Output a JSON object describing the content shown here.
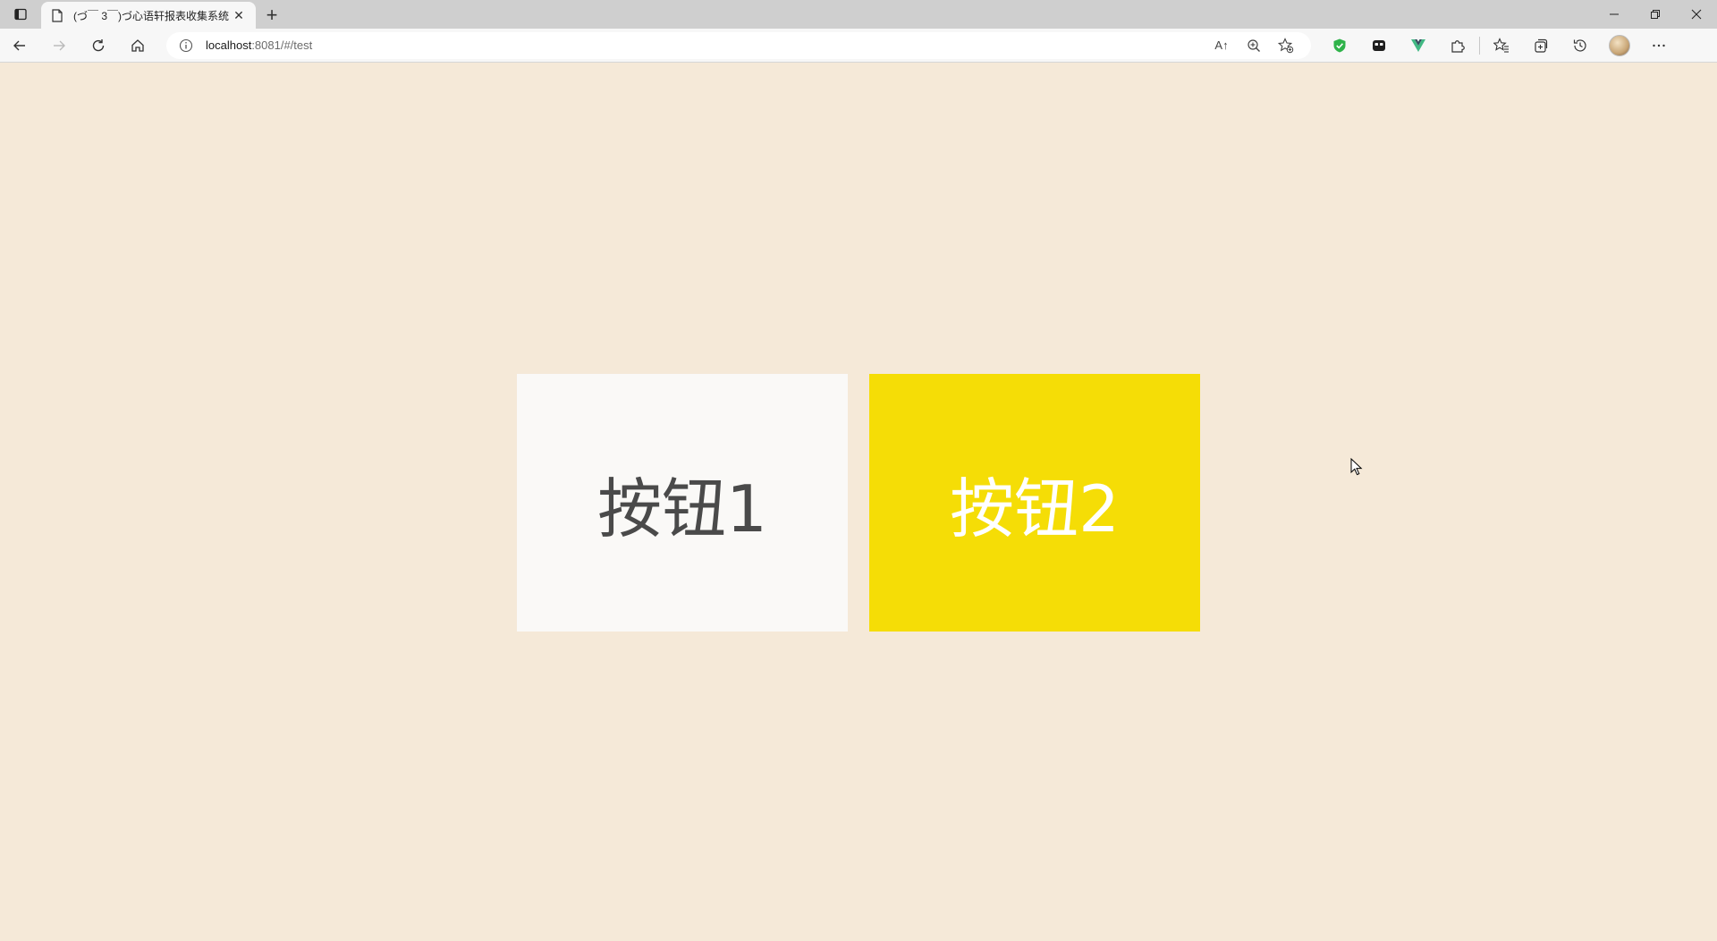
{
  "browser": {
    "tab": {
      "title": "(づ￣ 3￣)づ心语轩报表收集系统",
      "close_glyph": "✕"
    },
    "new_tab_glyph": "+",
    "address": {
      "url_host": "localhost",
      "url_rest": ":8081/#/test",
      "read_aloud_label": "A↑"
    }
  },
  "page": {
    "button1_label": "按钮1",
    "button2_label": "按钮2",
    "colors": {
      "background": "#f5e9d8",
      "button1_bg": "#faf9f7",
      "button1_text": "#4a4a4a",
      "button2_bg": "#f5dd06",
      "button2_text": "#ffffff"
    }
  },
  "icons": {
    "sidebar": "tab-actions-icon",
    "page": "page-icon",
    "back": "back-arrow-icon",
    "forward": "forward-arrow-icon",
    "refresh": "refresh-icon",
    "home": "home-icon",
    "info": "info-icon",
    "zoom": "zoom-icon",
    "favorite": "add-favorite-icon",
    "shield": "shield-extension-icon",
    "ext2": "extension-icon",
    "vue": "vue-devtools-icon",
    "puzzle": "extensions-puzzle-icon",
    "favorites": "favorites-icon",
    "collections": "collections-icon",
    "history": "history-icon",
    "profile": "profile-avatar",
    "more": "more-icon"
  }
}
